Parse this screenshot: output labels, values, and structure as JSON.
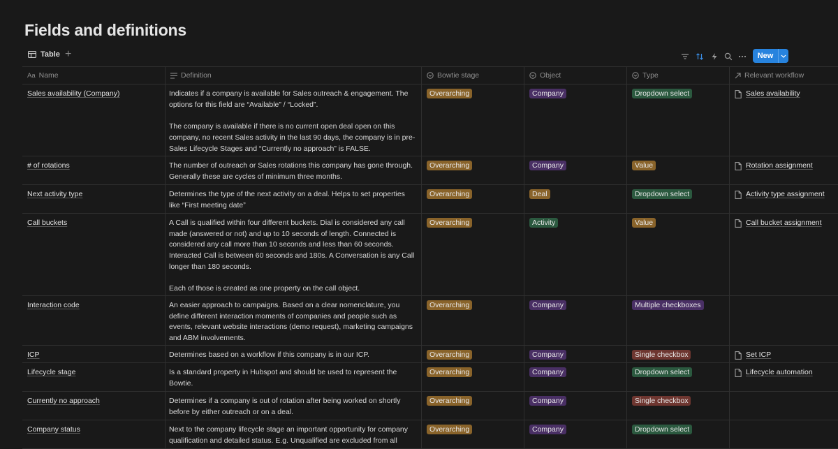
{
  "page": {
    "title": "Fields and definitions"
  },
  "view": {
    "tab_label": "Table",
    "add_label": "+",
    "new_label": "New"
  },
  "colors": {
    "background": "#191919",
    "accent": "#2783de",
    "Overarching": "#89632a",
    "Company": "#492f64",
    "Deal": "#89632a",
    "Activity": "#2b593f",
    "Dropdown select": "#2b593f",
    "Value": "#89632a",
    "Multiple checkboxes": "#492f64",
    "Single checkbox": "#6e3630"
  },
  "headers": {
    "name": "Name",
    "name_icon": "Aa",
    "definition": "Definition",
    "bowtie": "Bowtie stage",
    "object": "Object",
    "type": "Type",
    "workflow": "Relevant workflow"
  },
  "rows": [
    {
      "name": "Sales availability (Company)",
      "definition": [
        "Indicates if a company is available for Sales outreach & engagement. The options for this field are “Available” / “Locked”.",
        "The company is available if there is no current open deal open on this company, no recent Sales activity in the last 90 days, the company is in pre-Sales Lifecycle Stages and “Currently no approach” is FALSE."
      ],
      "bowtie": "Overarching",
      "object": "Company",
      "type": "Dropdown select",
      "workflow": "Sales availability",
      "h": 103
    },
    {
      "name": "# of rotations",
      "definition": [
        "The number of outreach or Sales rotations this company has gone through. Generally these are cycles of minimum three months."
      ],
      "bowtie": "Overarching",
      "object": "Company",
      "type": "Value",
      "workflow": "Rotation assignment",
      "h": 41
    },
    {
      "name": "Next activity type",
      "definition": [
        "Determines the type of the next activity on a deal. Helps to set properties like “First meeting date”"
      ],
      "bowtie": "Overarching",
      "object": "Deal",
      "type": "Dropdown select",
      "workflow": "Activity type assignment",
      "h": 41
    },
    {
      "name": "Call buckets",
      "definition": [
        "A Call is qualified within four different buckets. Dial is considered any call made (answered or not) and up to 10 seconds of length. Connected is considered any call more than 10 seconds and less than 60 seconds. Interacted Call is between 60 seconds and 180s. A Conversation is any Call longer than 180 seconds.",
        "Each of those is created as one property on the call object."
      ],
      "bowtie": "Overarching",
      "object": "Activity",
      "type": "Value",
      "workflow": "Call bucket assignment",
      "h": 118
    },
    {
      "name": "Interaction code",
      "definition": [
        "An easier approach to campaigns. Based on a clear nomenclature, you define different interaction moments of companies and people such as events, relevant website interactions (demo request), marketing campaigns and ABM involvements."
      ],
      "bowtie": "Overarching",
      "object": "Company",
      "type": "Multiple checkboxes",
      "workflow": "",
      "h": 71
    },
    {
      "name": "ICP",
      "definition": [
        "Determines based on a workflow if this company is in our ICP."
      ],
      "bowtie": "Overarching",
      "object": "Company",
      "type": "Single checkbox",
      "workflow": "Set ICP",
      "h": 25
    },
    {
      "name": "Lifecycle stage",
      "definition": [
        "Is a standard property in Hubspot and should be used to represent the Bowtie."
      ],
      "bowtie": "Overarching",
      "object": "Company",
      "type": "Dropdown select",
      "workflow": "Lifecycle automation",
      "h": 41
    },
    {
      "name": "Currently no approach",
      "definition": [
        "Determines if a company is out of rotation after being worked on shortly before by either outreach or on a deal."
      ],
      "bowtie": "Overarching",
      "object": "Company",
      "type": "Single checkbox",
      "workflow": "",
      "h": 41
    },
    {
      "name": "Company status",
      "definition": [
        "Next to the company lifecycle stage an important opportunity for company qualification and detailed status. E.g. Unqualified are excluded from all"
      ],
      "bowtie": "Overarching",
      "object": "Company",
      "type": "Dropdown select",
      "workflow": "",
      "h": 41
    }
  ]
}
